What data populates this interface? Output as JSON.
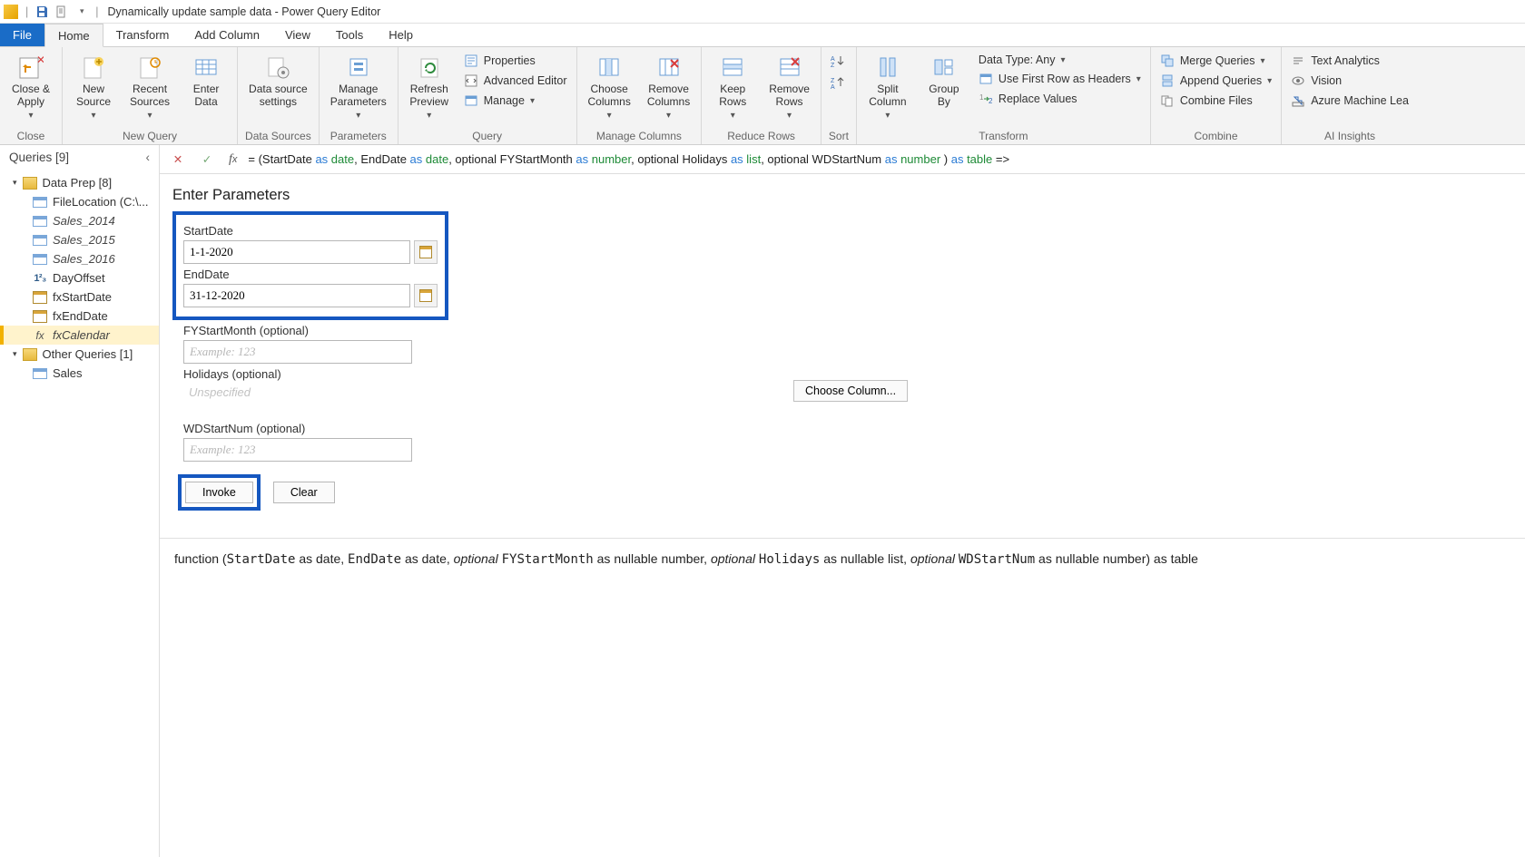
{
  "title_bar": {
    "title": "Dynamically update sample data - Power Query Editor"
  },
  "menu": {
    "file": "File",
    "tabs": [
      "Home",
      "Transform",
      "Add Column",
      "View",
      "Tools",
      "Help"
    ],
    "active": "Home"
  },
  "ribbon": {
    "close": {
      "close_apply": "Close &\nApply",
      "group": "Close"
    },
    "newquery": {
      "new_source": "New\nSource",
      "recent_sources": "Recent\nSources",
      "enter_data": "Enter\nData",
      "group": "New Query"
    },
    "datasources": {
      "data_source_settings": "Data source\nsettings",
      "group": "Data Sources"
    },
    "parameters": {
      "manage_parameters": "Manage\nParameters",
      "group": "Parameters"
    },
    "query": {
      "refresh_preview": "Refresh\nPreview",
      "properties": "Properties",
      "advanced_editor": "Advanced Editor",
      "manage": "Manage",
      "group": "Query"
    },
    "managecols": {
      "choose_cols": "Choose\nColumns",
      "remove_cols": "Remove\nColumns",
      "group": "Manage Columns"
    },
    "reducerows": {
      "keep_rows": "Keep\nRows",
      "remove_rows": "Remove\nRows",
      "group": "Reduce Rows"
    },
    "sort": {
      "group": "Sort"
    },
    "transform": {
      "split_col": "Split\nColumn",
      "group_by": "Group\nBy",
      "data_type": "Data Type: Any",
      "first_row_headers": "Use First Row as Headers",
      "replace_values": "Replace Values",
      "group": "Transform"
    },
    "combine": {
      "merge": "Merge Queries",
      "append": "Append Queries",
      "combine_files": "Combine Files",
      "group": "Combine"
    },
    "ai": {
      "text_analytics": "Text Analytics",
      "vision": "Vision",
      "azure_ml": "Azure Machine Lea",
      "group": "AI Insights"
    }
  },
  "queries": {
    "header": "Queries [9]",
    "group1": {
      "label": "Data Prep [8]",
      "items": [
        {
          "name": "FileLocation (C:\\...",
          "icon": "table"
        },
        {
          "name": "Sales_2014",
          "icon": "table",
          "italic": true
        },
        {
          "name": "Sales_2015",
          "icon": "table",
          "italic": true
        },
        {
          "name": "Sales_2016",
          "icon": "table",
          "italic": true
        },
        {
          "name": "DayOffset",
          "icon": "num"
        },
        {
          "name": "fxStartDate",
          "icon": "cal"
        },
        {
          "name": "fxEndDate",
          "icon": "cal"
        },
        {
          "name": "fxCalendar",
          "icon": "fx",
          "italic": true,
          "selected": true
        }
      ]
    },
    "group2": {
      "label": "Other Queries [1]",
      "items": [
        {
          "name": "Sales",
          "icon": "table"
        }
      ]
    }
  },
  "formula_bar": {
    "prefix": "= (StartDate ",
    "p1_as": "as ",
    "p1_type": "date",
    "sep1": ", EndDate ",
    "p2_as": "as ",
    "p2_type": "date",
    "sep2": ", optional FYStartMonth ",
    "p3_as": "as ",
    "p3_type": "number",
    "sep3": ", optional Holidays ",
    "p4_as": "as ",
    "p4_type": "list",
    "sep4": ", optional WDStartNum ",
    "p5_as": "as ",
    "p5_type": "number",
    "end": " ) ",
    "ret_as": "as ",
    "ret_type": "table",
    "arrow": " =>"
  },
  "params": {
    "title": "Enter Parameters",
    "start_label": "StartDate",
    "start_value": "1-1-2020",
    "end_label": "EndDate",
    "end_value": "31-12-2020",
    "fystart_label": "FYStartMonth (optional)",
    "fystart_placeholder": "Example: 123",
    "holidays_label": "Holidays (optional)",
    "holidays_unspecified": "Unspecified",
    "choose_col": "Choose Column...",
    "wdstart_label": "WDStartNum (optional)",
    "wdstart_placeholder": "Example: 123",
    "invoke": "Invoke",
    "clear": "Clear"
  },
  "signature": {
    "pre": "function (",
    "p1_name": "StartDate",
    "p1_rest": " as date, ",
    "p2_name": "EndDate",
    "p2_rest": " as date, ",
    "opt": "optional ",
    "p3_name": "FYStartMonth",
    "p3_rest": " as nullable number, ",
    "p4_name": "Holidays",
    "p4_rest": " as nullable list, ",
    "p5_name": "WDStartNum",
    "p5_rest": " as nullable number) as table"
  }
}
